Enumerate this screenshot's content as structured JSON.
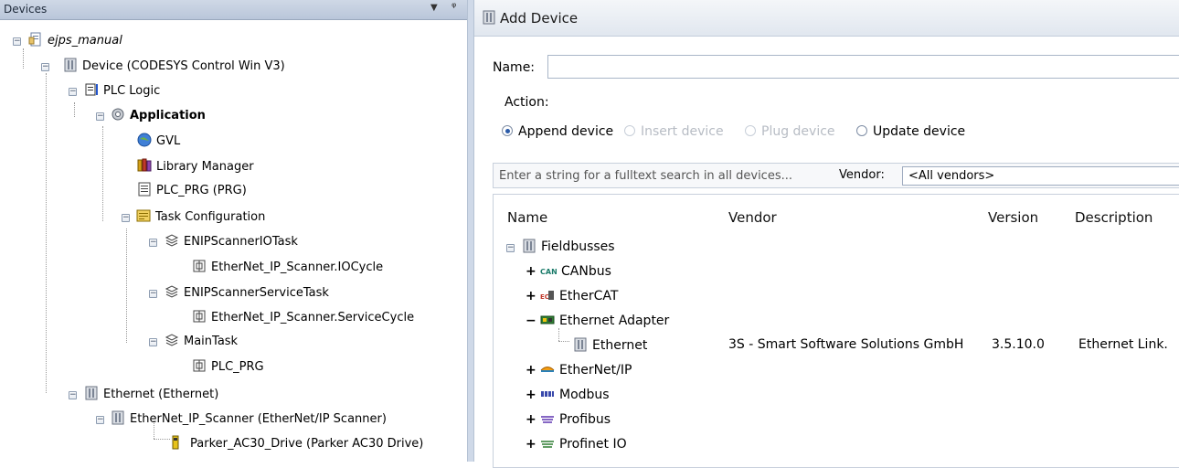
{
  "devices_pane": {
    "title": "Devices",
    "tree": [
      {
        "label": "ejps_manual",
        "style": "italic"
      },
      {
        "label": "Device (CODESYS Control Win V3)"
      },
      {
        "label": "PLC Logic"
      },
      {
        "label": "Application",
        "style": "bold"
      },
      {
        "label": "GVL"
      },
      {
        "label": "Library Manager"
      },
      {
        "label": "PLC_PRG (PRG)"
      },
      {
        "label": "Task Configuration"
      },
      {
        "label": "ENIPScannerIOTask"
      },
      {
        "label": "EtherNet_IP_Scanner.IOCycle"
      },
      {
        "label": "ENIPScannerServiceTask"
      },
      {
        "label": "EtherNet_IP_Scanner.ServiceCycle"
      },
      {
        "label": "MainTask"
      },
      {
        "label": "PLC_PRG"
      },
      {
        "label": "Ethernet (Ethernet)"
      },
      {
        "label": "EtherNet_IP_Scanner (EtherNet/IP Scanner)"
      },
      {
        "label": "Parker_AC30_Drive (Parker AC30 Drive)"
      }
    ]
  },
  "add_device": {
    "title": "Add Device",
    "name_label": "Name:",
    "name_value": "",
    "action_label": "Action:",
    "actions": [
      {
        "label": "Append device",
        "selected": true,
        "enabled": true
      },
      {
        "label": "Insert device",
        "selected": false,
        "enabled": false
      },
      {
        "label": "Plug device",
        "selected": false,
        "enabled": false
      },
      {
        "label": "Update device",
        "selected": false,
        "enabled": true
      }
    ],
    "search_placeholder": "Enter a string for a fulltext search in all devices...",
    "vendor_label": "Vendor:",
    "vendor_value": "<All vendors>",
    "columns": [
      "Name",
      "Vendor",
      "Version",
      "Description"
    ],
    "rows": [
      {
        "name": "Fieldbusses",
        "toggle": "-",
        "vendor": "",
        "version": "",
        "description": ""
      },
      {
        "name": "CANbus",
        "toggle": "+",
        "vendor": "",
        "version": "",
        "description": ""
      },
      {
        "name": "EtherCAT",
        "toggle": "+",
        "vendor": "",
        "version": "",
        "description": ""
      },
      {
        "name": "Ethernet Adapter",
        "toggle": "-",
        "vendor": "",
        "version": "",
        "description": ""
      },
      {
        "name": "Ethernet",
        "toggle": "",
        "vendor": "3S - Smart Software Solutions GmbH",
        "version": "3.5.10.0",
        "description": "Ethernet Link."
      },
      {
        "name": "EtherNet/IP",
        "toggle": "+",
        "vendor": "",
        "version": "",
        "description": ""
      },
      {
        "name": "Modbus",
        "toggle": "+",
        "vendor": "",
        "version": "",
        "description": ""
      },
      {
        "name": "Profibus",
        "toggle": "+",
        "vendor": "",
        "version": "",
        "description": ""
      },
      {
        "name": "Profinet IO",
        "toggle": "+",
        "vendor": "",
        "version": "",
        "description": ""
      }
    ]
  }
}
